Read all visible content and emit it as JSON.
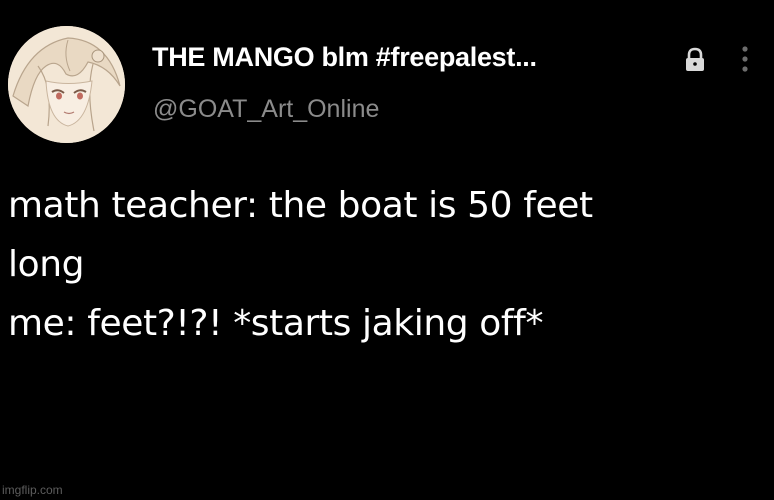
{
  "user": {
    "display_name": "THE MANGO blm #freepalest...",
    "handle": "@GOAT_Art_Online"
  },
  "tweet": {
    "lines": [
      "math teacher: the boat is 50 feet",
      "long",
      "me: feet?!?! *starts jaking off*"
    ]
  },
  "watermark": "imgflip.com",
  "icons": {
    "lock": "lock-icon",
    "more": "more-vertical-icon",
    "avatar": "anime-avatar"
  },
  "colors": {
    "background": "#000000",
    "text": "#ffffff",
    "secondary_text": "#8b8b8b"
  }
}
